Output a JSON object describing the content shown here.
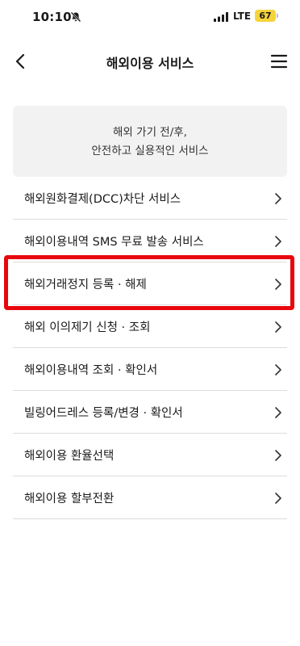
{
  "status_bar": {
    "time": "10:10",
    "network": "LTE",
    "battery": "67"
  },
  "header": {
    "title": "해외이용 서비스",
    "back_icon": "chevron-left-icon",
    "menu_icon": "hamburger-menu-icon"
  },
  "intro": {
    "line1": "해외 가기 전/후,",
    "line2": "안전하고 실용적인 서비스"
  },
  "menu": {
    "items": [
      {
        "label": "해외원화결제(DCC)차단 서비스"
      },
      {
        "label": "해외이용내역 SMS 무료 발송 서비스"
      },
      {
        "label": "해외거래정지 등록 · 해제"
      },
      {
        "label": "해외 이의제기 신청 · 조회"
      },
      {
        "label": "해외이용내역 조회 · 확인서"
      },
      {
        "label": "빌링어드레스 등록/변경 · 확인서"
      },
      {
        "label": "해외이용 환율선택"
      },
      {
        "label": "해외이용 할부전환"
      }
    ]
  },
  "highlight": {
    "color": "#e8070d",
    "target_item": "해외거래정지 등록 · 해제"
  }
}
